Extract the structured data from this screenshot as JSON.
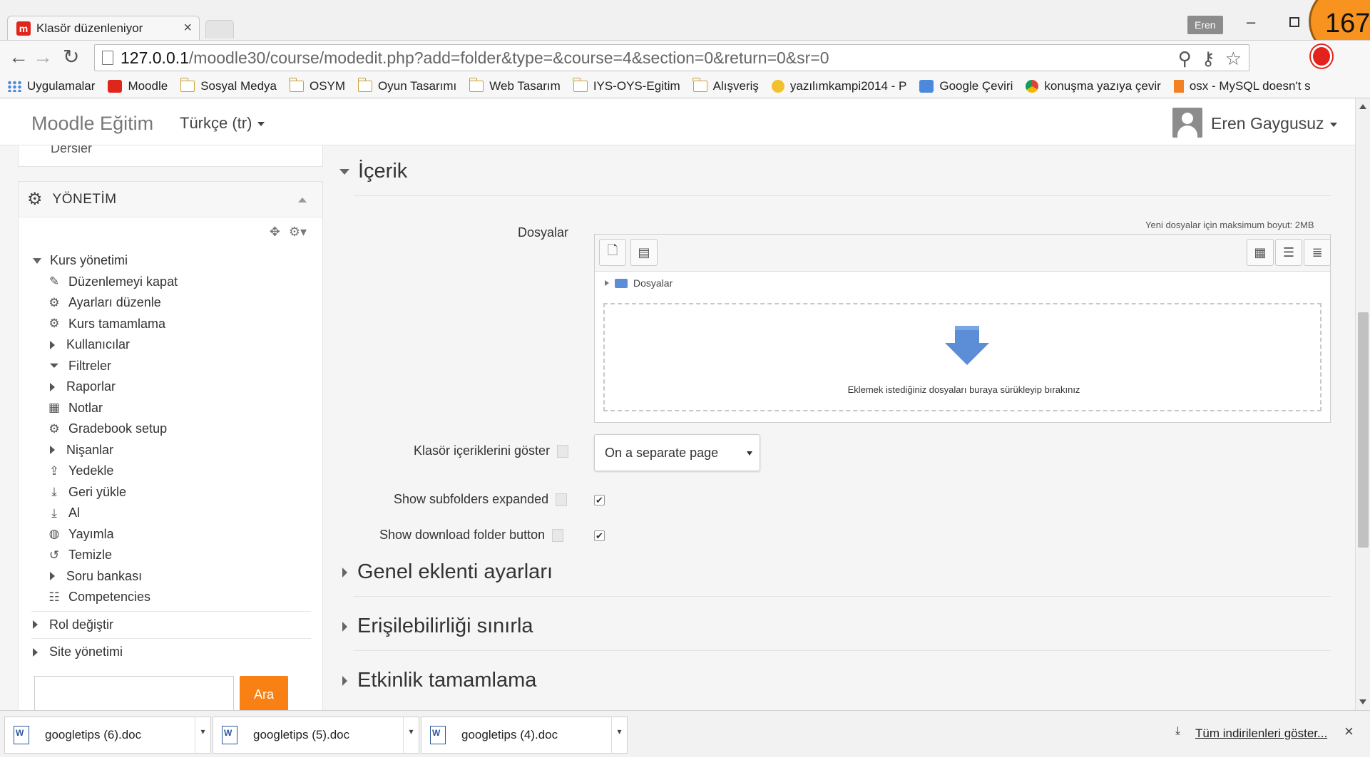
{
  "browser": {
    "tab_title": "Klasör düzenleniyor",
    "tab_close": "×",
    "profile_name": "Eren",
    "window_min": "–",
    "counter": "167",
    "url_host": "127.0.0.1",
    "url_path": "/moodle30/course/modedit.php?add=folder&type=&course=4&section=0&return=0&sr=0",
    "nav_back": "←",
    "nav_forward": "→",
    "nav_reload": "↻",
    "bookmarks": [
      {
        "label": "Uygulamalar",
        "icon": "apps-icon"
      },
      {
        "label": "Moodle",
        "icon": "moodle-icon"
      },
      {
        "label": "Sosyal Medya",
        "icon": "folder-icon"
      },
      {
        "label": "OSYM",
        "icon": "folder-icon"
      },
      {
        "label": "Oyun Tasarımı",
        "icon": "folder-icon"
      },
      {
        "label": "Web Tasarım",
        "icon": "folder-icon"
      },
      {
        "label": "IYS-OYS-Egitim",
        "icon": "folder-icon"
      },
      {
        "label": "Alışveriş",
        "icon": "folder-icon"
      },
      {
        "label": "yazılımkampi2014 - P",
        "icon": "bird-icon"
      },
      {
        "label": "Google Çeviri",
        "icon": "translate-icon"
      },
      {
        "label": "konuşma yazıya çevir",
        "icon": "chrome-icon"
      },
      {
        "label": "osx - MySQL doesn't s",
        "icon": "stackoverflow-icon"
      }
    ]
  },
  "navbar": {
    "brand": "Moodle Eğitim",
    "language": "Türkçe (tr)",
    "user_name": "Eren Gaygusuz"
  },
  "sidebar": {
    "top_block_label": "Dersler",
    "block_title": "YÖNETİM",
    "root_label": "Kurs yönetimi",
    "items": [
      {
        "label": "Düzenlemeyi kapat",
        "icon": "pencil-icon",
        "expandable": false
      },
      {
        "label": "Ayarları düzenle",
        "icon": "gear-icon",
        "expandable": false
      },
      {
        "label": "Kurs tamamlama",
        "icon": "gear-icon",
        "expandable": false
      },
      {
        "label": "Kullanıcılar",
        "icon": "",
        "expandable": true
      },
      {
        "label": "Filtreler",
        "icon": "filter-icon",
        "expandable": false
      },
      {
        "label": "Raporlar",
        "icon": "",
        "expandable": true
      },
      {
        "label": "Notlar",
        "icon": "grades-table-icon",
        "expandable": false
      },
      {
        "label": "Gradebook setup",
        "icon": "gear-icon",
        "expandable": false
      },
      {
        "label": "Nişanlar",
        "icon": "",
        "expandable": true
      },
      {
        "label": "Yedekle",
        "icon": "upload-icon",
        "expandable": false
      },
      {
        "label": "Geri yükle",
        "icon": "download-icon",
        "expandable": false
      },
      {
        "label": "Al",
        "icon": "download-icon",
        "expandable": false
      },
      {
        "label": "Yayımla",
        "icon": "globe-icon",
        "expandable": false
      },
      {
        "label": "Temizle",
        "icon": "reset-icon",
        "expandable": false
      },
      {
        "label": "Soru bankası",
        "icon": "",
        "expandable": true
      },
      {
        "label": "Competencies",
        "icon": "competencies-icon",
        "expandable": false
      }
    ],
    "rol_label": "Rol değiştir",
    "site_label": "Site yönetimi",
    "search_button": "Ara"
  },
  "content": {
    "section_title": "İçerik",
    "files_label": "Dosyalar",
    "max_size": "Yeni dosyalar için maksimum boyut: 2MB",
    "path_folder": "Dosyalar",
    "drop_text": "Eklemek istediğiniz dosyaları buraya sürükleyip bırakınız",
    "display_label": "Klasör içeriklerini göster",
    "display_value": "On a separate page",
    "subfolders_label": "Show subfolders expanded",
    "subfolders_checked": true,
    "download_label": "Show download folder button",
    "download_checked": true,
    "sections": [
      "Genel eklenti ayarları",
      "Erişilebilirliği sınırla",
      "Etkinlik tamamlama"
    ]
  },
  "downloads": {
    "items": [
      "googletips (6).doc",
      "googletips (5).doc",
      "googletips (4).doc"
    ],
    "show_all": "Tüm indirilenleri göster...",
    "close": "×"
  },
  "colors": {
    "accent_orange": "#f98012",
    "moodle_red": "#e0261b",
    "drop_arrow_blue": "#5b8ed6"
  }
}
